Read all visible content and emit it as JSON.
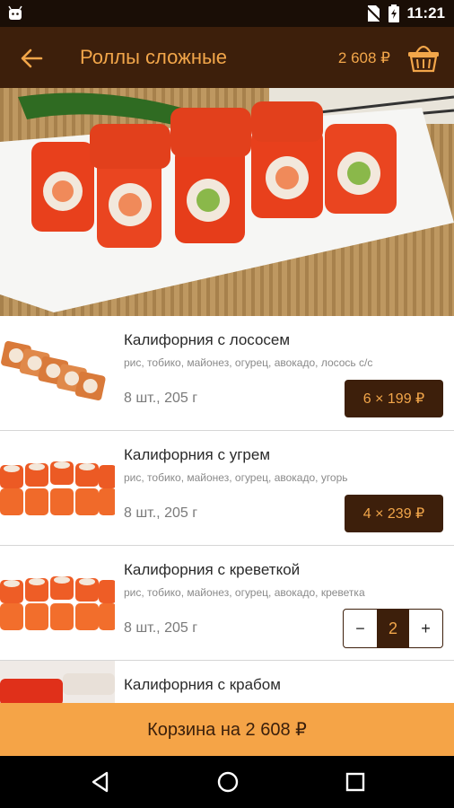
{
  "status_bar": {
    "time": "11:21"
  },
  "app_bar": {
    "title": "Роллы сложные",
    "cart_total": "2 608 ₽"
  },
  "items": [
    {
      "name": "Калифорния с лососем",
      "description": "рис, тобико, майонез, огурец, авокадо, лосось с/с",
      "meta": "8 шт., 205 г",
      "price_label": "6 × 199 ₽"
    },
    {
      "name": "Калифорния с угрем",
      "description": "рис, тобико, майонез, огурец, авокадо, угорь",
      "meta": "8 шт., 205 г",
      "price_label": "4 × 239 ₽"
    },
    {
      "name": "Калифорния с креветкой",
      "description": "рис, тобико, майонез, огурец, авокадо, креветка",
      "meta": "8 шт., 205 г",
      "stepper": {
        "minus": "−",
        "quantity": "2",
        "plus": "+"
      }
    },
    {
      "name": "Калифорния с крабом"
    }
  ],
  "cart_button": {
    "label": "Корзина на 2 608 ₽"
  },
  "colors": {
    "brand_dark": "#3d1f0b",
    "accent": "#f5a447",
    "accent_text": "#f2a64a"
  },
  "icons": [
    "android-icon",
    "no-sim-icon",
    "battery-icon",
    "back-arrow-icon",
    "basket-icon",
    "nav-back-icon",
    "nav-home-icon",
    "nav-recents-icon"
  ]
}
